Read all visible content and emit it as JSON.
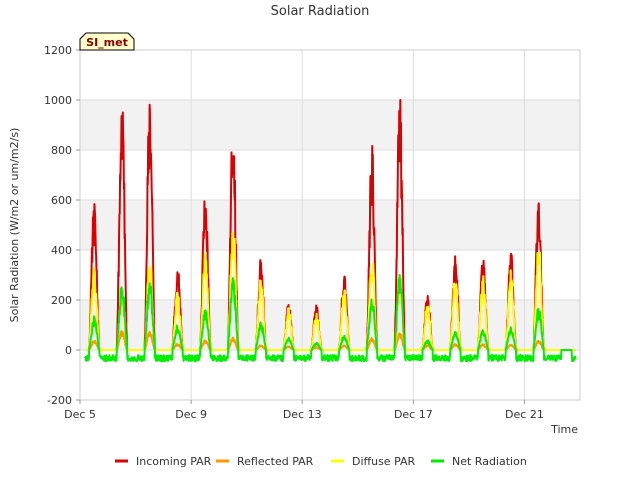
{
  "chart_data": {
    "type": "line",
    "title": "Solar Radiation",
    "xlabel": "Time",
    "ylabel": "Solar Radiation (W/m2 or um/m2/s)",
    "ylim": [
      -200,
      1200
    ],
    "yticks": [
      -200,
      0,
      200,
      400,
      600,
      800,
      1000,
      1200
    ],
    "xlim": [
      5.0,
      23.0
    ],
    "xticks": [
      {
        "value": 5,
        "label": "Dec 5"
      },
      {
        "value": 9,
        "label": "Dec 9"
      },
      {
        "value": 13,
        "label": "Dec 13"
      },
      {
        "value": 17,
        "label": "Dec 17"
      },
      {
        "value": 21,
        "label": "Dec 21"
      }
    ],
    "banded_background": true,
    "legend_position": "bottom",
    "site_badge": "SI_met",
    "day_peaks": [
      {
        "day": 5,
        "incoming": 598,
        "reflected": 40,
        "diffuse": 350,
        "net": 135
      },
      {
        "day": 6,
        "incoming": 1030,
        "reflected": 80,
        "diffuse": 260,
        "net": 275
      },
      {
        "day": 7,
        "incoming": 1035,
        "reflected": 80,
        "diffuse": 380,
        "net": 290
      },
      {
        "day": 8,
        "incoming": 350,
        "reflected": 25,
        "diffuse": 240,
        "net": 100
      },
      {
        "day": 9,
        "incoming": 655,
        "reflected": 40,
        "diffuse": 400,
        "net": 165
      },
      {
        "day": 10,
        "incoming": 940,
        "reflected": 50,
        "diffuse": 540,
        "net": 300
      },
      {
        "day": 11,
        "incoming": 375,
        "reflected": 20,
        "diffuse": 300,
        "net": 115
      },
      {
        "day": 12,
        "incoming": 205,
        "reflected": 15,
        "diffuse": 170,
        "net": 50
      },
      {
        "day": 13,
        "incoming": 190,
        "reflected": 12,
        "diffuse": 150,
        "net": 30
      },
      {
        "day": 14,
        "incoming": 305,
        "reflected": 20,
        "diffuse": 250,
        "net": 60
      },
      {
        "day": 15,
        "incoming": 830,
        "reflected": 50,
        "diffuse": 400,
        "net": 215
      },
      {
        "day": 16,
        "incoming": 1025,
        "reflected": 70,
        "diffuse": 300,
        "net": 320
      },
      {
        "day": 17,
        "incoming": 230,
        "reflected": 20,
        "diffuse": 200,
        "net": 40
      },
      {
        "day": 18,
        "incoming": 380,
        "reflected": 25,
        "diffuse": 300,
        "net": 75
      },
      {
        "day": 19,
        "incoming": 395,
        "reflected": 25,
        "diffuse": 300,
        "net": 80
      },
      {
        "day": 20,
        "incoming": 405,
        "reflected": 25,
        "diffuse": 330,
        "net": 95
      },
      {
        "day": 21,
        "incoming": 620,
        "reflected": 40,
        "diffuse": 440,
        "net": 175
      }
    ],
    "series": [
      {
        "name": "Incoming PAR",
        "color": "#dd0000",
        "key": "incoming"
      },
      {
        "name": "Reflected PAR",
        "color": "#ff9900",
        "key": "reflected"
      },
      {
        "name": "Diffuse PAR",
        "color": "#ffff00",
        "key": "diffuse"
      },
      {
        "name": "Net Radiation",
        "color": "#00ee00",
        "key": "net"
      }
    ]
  }
}
